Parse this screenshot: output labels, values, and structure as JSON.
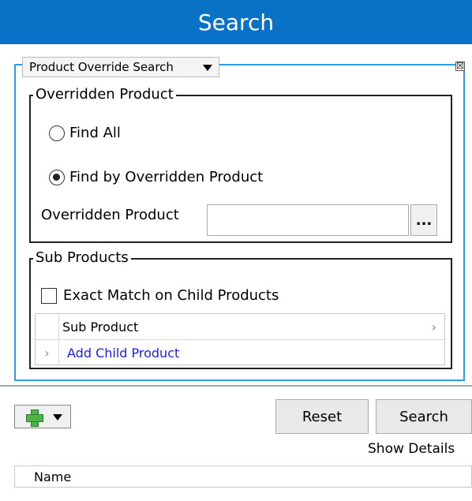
{
  "window": {
    "title": "Search"
  },
  "search_panel": {
    "type_selector": "Product Override Search",
    "close_glyph": "☒",
    "overridden_group": {
      "legend": "Overridden Product",
      "radio_find_all": {
        "label": "Find All",
        "checked": false
      },
      "radio_find_by": {
        "label": "Find by Overridden Product",
        "checked": true
      },
      "field_label": "Overridden Product",
      "field_value": "",
      "browse_label": "..."
    },
    "sub_products_group": {
      "legend": "Sub Products",
      "exact_match": {
        "label": "Exact Match on Child Products",
        "checked": false
      },
      "grid": {
        "column_header": "Sub Product",
        "add_row_label": "Add Child Product",
        "add_row_color": "#1a1aff"
      }
    }
  },
  "footer": {
    "add_icon": "green-plus-icon",
    "reset_label": "Reset",
    "search_label": "Search",
    "show_details_label": "Show Details"
  },
  "results": {
    "columns": [
      "Name"
    ]
  },
  "colors": {
    "titlebar": "#0a72c6",
    "panel_border": "#2e9de6"
  }
}
